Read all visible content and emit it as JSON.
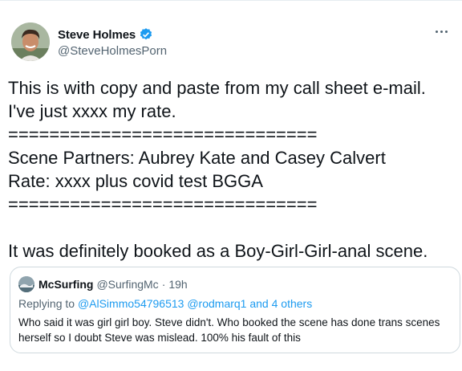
{
  "author": {
    "display_name": "Steve Holmes",
    "handle": "@SteveHolmesPorn",
    "verified_icon": "verified-badge-icon",
    "badge_color": "#1d9bf0"
  },
  "tweet": {
    "lines": [
      "This is with copy and paste from my call sheet e-mail.",
      "I've just xxxx my rate.",
      "==============================",
      "Scene Partners: Aubrey Kate and Casey Calvert",
      "Rate: xxxx plus covid test BGGA",
      "==============================",
      "It was definitely booked as a Boy-Girl-Girl-anal scene."
    ]
  },
  "quoted_tweet": {
    "display_name": "McSurfing",
    "handle": "@SurfingMc",
    "dot": "·",
    "time": "19h",
    "replying_prefix": "Replying to ",
    "replying_users": "@AlSimmo54796513 @rodmarq1",
    "replying_suffix": " and 4 others",
    "text": "Who said it was girl girl boy.  Steve didn't.  Who booked the scene has done trans scenes herself so I doubt Steve was mislead.  100% his fault of this"
  }
}
